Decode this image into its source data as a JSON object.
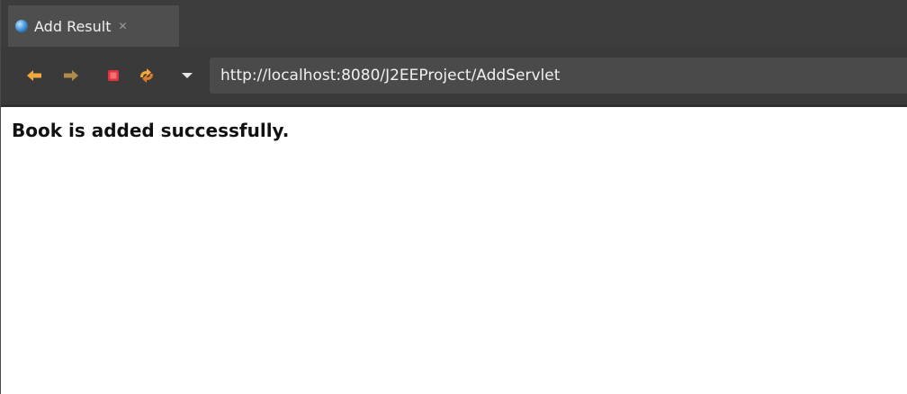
{
  "tab": {
    "label": "Add Result",
    "close_glyph": "✕",
    "icon": "globe-icon"
  },
  "nav": {
    "back_icon": "arrow-left-icon",
    "forward_icon": "arrow-right-icon",
    "stop_icon": "stop-icon",
    "refresh_icon": "refresh-icon",
    "dropdown_icon": "chevron-down-icon",
    "url": "http://localhost:8080/J2EEProject/AddServlet"
  },
  "page": {
    "message": "Book is added successfully."
  },
  "colors": {
    "chrome_dark": "#3c3c3c",
    "tab_active": "#4e4e4e",
    "url_field": "#4a4a4a",
    "back_arrow": "#f2a93b",
    "forward_arrow": "#c89a4f",
    "stop": "#e0353e"
  }
}
